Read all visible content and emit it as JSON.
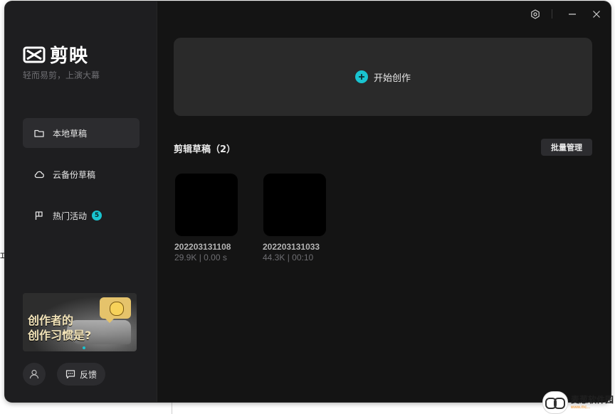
{
  "app": {
    "name": "剪映",
    "slogan": "轻而易剪，上演大幕"
  },
  "sidebar": {
    "items": [
      {
        "label": "本地草稿",
        "icon": "folder-icon",
        "active": true
      },
      {
        "label": "云备份草稿",
        "icon": "cloud-icon",
        "active": false
      },
      {
        "label": "热门活动",
        "icon": "flag-icon",
        "active": false,
        "badge": "5"
      }
    ],
    "promo": {
      "text_line1": "创作者的",
      "text_line2": "创作习惯是?"
    },
    "avatar_icon": "user-icon",
    "feedback_label": "反馈",
    "feedback_icon": "message-icon"
  },
  "titlebar": {
    "icons": [
      "settings-icon",
      "minimize-icon",
      "close-icon"
    ]
  },
  "main": {
    "create_label": "开始创作",
    "section_title": "剪辑草稿（2）",
    "batch_label": "批量管理",
    "drafts": [
      {
        "name": "202203131108",
        "meta": "29.9K | 0.00 s"
      },
      {
        "name": "202203131033",
        "meta": "44.3K | 00:10"
      }
    ]
  },
  "watermark": {
    "main": "麦葱软件园",
    "sub": "www.mc..."
  },
  "colors": {
    "accent": "#19c4d0",
    "sidebar_bg": "#1e1e20",
    "main_bg": "#141414",
    "card_bg": "#2a2a2a"
  }
}
